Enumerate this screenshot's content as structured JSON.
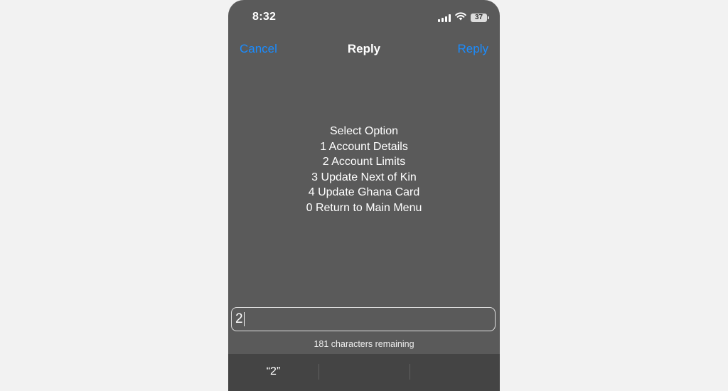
{
  "status_bar": {
    "time": "8:32",
    "battery_level": "37",
    "icons": [
      "cellular-signal-icon",
      "wifi-icon",
      "battery-icon"
    ]
  },
  "nav": {
    "cancel_label": "Cancel",
    "title": "Reply",
    "reply_label": "Reply",
    "accent_color": "#1a8cff"
  },
  "message": {
    "lines": [
      "Select Option",
      "1 Account Details",
      "2 Account Limits",
      "3 Update Next of Kin",
      "4 Update Ghana Card",
      "0 Return to Main Menu"
    ]
  },
  "reply_field": {
    "value": "2"
  },
  "char_count": "181 characters remaining",
  "suggestions": [
    "“2”",
    "",
    ""
  ]
}
